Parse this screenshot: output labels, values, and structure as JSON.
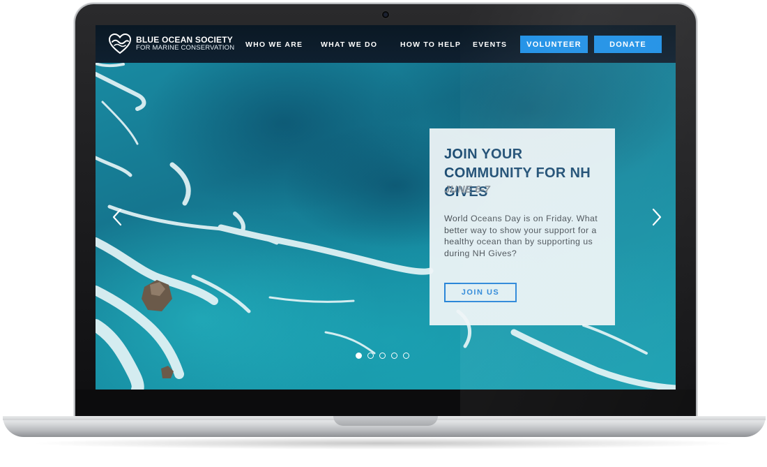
{
  "site": {
    "name": "BLUE OCEAN SOCIETY",
    "tagline": "FOR MARINE CONSERVATION",
    "accent_color": "#1e90e6",
    "logo_icon": "heart-wave-icon"
  },
  "nav": {
    "items": [
      {
        "label": "WHO WE ARE"
      },
      {
        "label": "WHAT WE DO"
      },
      {
        "label": "HOW TO HELP"
      },
      {
        "label": "EVENTS"
      }
    ],
    "volunteer_label": "VOLUNTEER",
    "donate_label": "DONATE"
  },
  "hero": {
    "title": "JOIN YOUR COMMUNITY FOR NH GIVES",
    "date": "JUNE 6-7",
    "body": "World Oceans Day is on Friday. What better way to show your support for a healthy ocean than by supporting us during NH Gives?",
    "cta_label": "JOIN US",
    "prev_icon": "chevron-left-icon",
    "next_icon": "chevron-right-icon",
    "slides_total": 5,
    "active_slide": 1
  }
}
